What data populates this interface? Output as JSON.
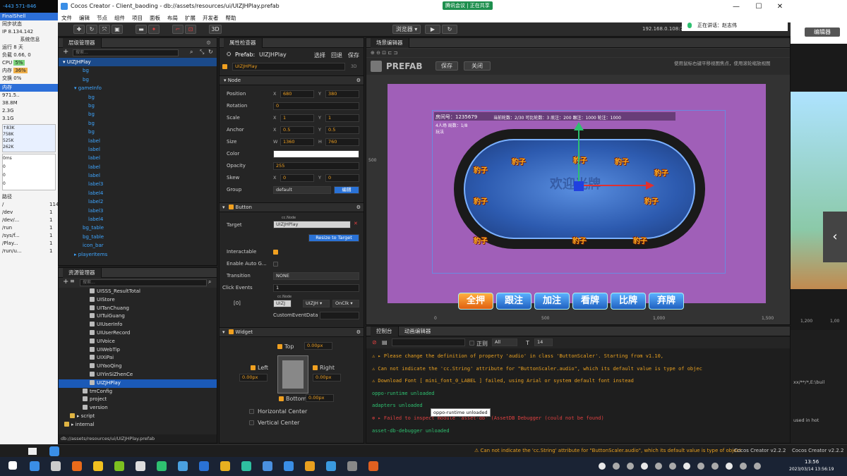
{
  "window": {
    "title": "Cocos Creator - Client_baoding - db://assets/resources/ui/UIZJHPlay.prefab",
    "minimize": "—",
    "maximize": "☐",
    "close": "✕",
    "meeting_badge": "腾讯会议 | 正在共享"
  },
  "menu": [
    "文件",
    "编辑",
    "节点",
    "组件",
    "项目",
    "面板",
    "布局",
    "扩展",
    "开发者",
    "帮助"
  ],
  "toolbar": {
    "mode_3d": "3D",
    "preview_target": "浏览器 ▾",
    "play": "▶",
    "refresh": "↻",
    "ip": "192.168.0.108:74"
  },
  "sysmon": {
    "top_value": "-443 571-846",
    "title": "FinalShell",
    "sync": "同步状态",
    "ip": "IP 8.134.142",
    "sysinfo": "系统信息",
    "uptime": "运行 8 天",
    "load": "负载 0.66, 0",
    "cpu": "CPU",
    "mem": "内存",
    "swap": "交换",
    "cpu_val": "5%",
    "mem_val": "36%",
    "swap_val": "0%",
    "tab1": "内存",
    "rows1": [
      "971.5..",
      "38.8M",
      "2.3G",
      "3.1G"
    ],
    "net": [
      "↑83K",
      "758K",
      "525K",
      "262K"
    ],
    "latency": [
      "0ms",
      "0",
      "0",
      "0"
    ],
    "paths_header": "路径",
    "paths": [
      "/",
      "/dev",
      "/dev/...",
      "/run",
      "/sys/f...",
      "/Play...",
      "/run/u..."
    ],
    "sizes": [
      "114",
      "1",
      "1",
      "1",
      "1",
      "1",
      "1"
    ]
  },
  "hierarchy": {
    "tab": "层级管理器",
    "search_placeholder": "搜索...",
    "items": [
      {
        "label": "▾ UIZJHPlay",
        "indent": 6,
        "selected": true
      },
      {
        "label": "bg",
        "indent": 34
      },
      {
        "label": "bg",
        "indent": 34
      },
      {
        "label": "▾ gameInfo",
        "indent": 22
      },
      {
        "label": "bg",
        "indent": 42
      },
      {
        "label": "bg",
        "indent": 42
      },
      {
        "label": "bg",
        "indent": 42
      },
      {
        "label": "bg",
        "indent": 42
      },
      {
        "label": "bg",
        "indent": 42
      },
      {
        "label": "label",
        "indent": 42
      },
      {
        "label": "label",
        "indent": 42
      },
      {
        "label": "label",
        "indent": 42
      },
      {
        "label": "label",
        "indent": 42
      },
      {
        "label": "label",
        "indent": 42
      },
      {
        "label": "label3",
        "indent": 42
      },
      {
        "label": "label4",
        "indent": 42
      },
      {
        "label": "label2",
        "indent": 42
      },
      {
        "label": "label3",
        "indent": 42
      },
      {
        "label": "label4",
        "indent": 42
      },
      {
        "label": "bg_table",
        "indent": 34
      },
      {
        "label": "bg_table",
        "indent": 34
      },
      {
        "label": "icon_bar",
        "indent": 34
      },
      {
        "label": "▸ playerItems",
        "indent": 22
      }
    ]
  },
  "assets": {
    "tab": "资源管理器",
    "search_placeholder": "搜索...",
    "items": [
      {
        "label": "UISSS_ResultTotal",
        "indent": 44
      },
      {
        "label": "UIStore",
        "indent": 44
      },
      {
        "label": "UITanChuang",
        "indent": 44
      },
      {
        "label": "UITuiGuang",
        "indent": 44
      },
      {
        "label": "UIUserInfo",
        "indent": 44
      },
      {
        "label": "UIUserRecord",
        "indent": 44
      },
      {
        "label": "UIVoice",
        "indent": 44
      },
      {
        "label": "UIWebTip",
        "indent": 44
      },
      {
        "label": "UIXiPai",
        "indent": 44
      },
      {
        "label": "UIYaoQing",
        "indent": 44
      },
      {
        "label": "UIYinSiZhenCe",
        "indent": 44
      },
      {
        "label": "UIZJHPlay",
        "indent": 44,
        "selected": true
      },
      {
        "label": "tmConfig",
        "indent": 34
      },
      {
        "label": "project",
        "indent": 34
      },
      {
        "label": "version",
        "indent": 34
      },
      {
        "label": "▸ script",
        "indent": 16,
        "folder": true
      },
      {
        "label": "▸ internal",
        "indent": 8,
        "folder": true
      }
    ],
    "path": "db://assets/resources/ui/UIZJHPlay.prefab"
  },
  "inspector": {
    "tab": "属性检查器",
    "prefab_label": "Prefab:",
    "prefab_name": "UIZJHPlay",
    "btn_select": "选择",
    "btn_revert": "回退",
    "btn_save": "保存",
    "node_name": "UIZJHPlay",
    "node_3d": "3D",
    "node_section": "Node",
    "position": {
      "label": "Position",
      "x": "680",
      "y": "380"
    },
    "rotation": {
      "label": "Rotation",
      "value": "0"
    },
    "scale": {
      "label": "Scale",
      "x": "1",
      "y": "1"
    },
    "anchor": {
      "label": "Anchor",
      "x": "0.5",
      "y": "0.5"
    },
    "size": {
      "label": "Size",
      "w": "1360",
      "h": "760"
    },
    "color_label": "Color",
    "opacity": {
      "label": "Opacity",
      "value": "255"
    },
    "skew": {
      "label": "Skew",
      "x": "0",
      "y": "0"
    },
    "group": {
      "label": "Group",
      "value": "default",
      "edit": "编辑"
    },
    "button_section": "Button",
    "target": {
      "label": "Target",
      "tag": "cc.Node",
      "value": "UIZJHPlay"
    },
    "resize_btn": "Resize to Target",
    "interactable": "Interactable",
    "enable_auto": "Enable Auto G...",
    "transition": {
      "label": "Transition",
      "value": "NONE"
    },
    "click_events": {
      "label": "Click Events",
      "value": "1"
    },
    "event0": {
      "index": "[0]",
      "node": "UIZJ",
      "comp": "UIZJH ▾",
      "handler": "OnClk ▾",
      "tag": "cc.Node"
    },
    "custom_data": "CustomEventData",
    "widget_section": "Widget",
    "widget": {
      "top": "Top",
      "top_val": "0.00px",
      "left": "Left",
      "left_val": "0.00px",
      "right": "Right",
      "right_val": "0.00px",
      "bottom": "Bottom",
      "bottom_val": "0.00px",
      "hcenter": "Horizontal Center",
      "vcenter": "Vertical Center"
    }
  },
  "scene": {
    "tab": "场景编辑器",
    "prefab_mode": "PREFAB",
    "save": "保存",
    "close": "关闭",
    "hint": "使用鼠标右键平移视图焦点，使用滚轮缩放视图",
    "ruler_left": "500",
    "ruler_bottom": [
      "0",
      "500",
      "1,000",
      "1,500"
    ],
    "room_info": "房间号：1235679",
    "players_info": "4人场  局数：1/8",
    "play_type": "玩法",
    "stats": "当前轮数：2/30   可比轮数：3   底注：200   跟注：1000   轮注：1000",
    "watermark": "欢迎光牌",
    "seat_label": "豹子",
    "buttons": [
      {
        "label": "全押",
        "style": "orange"
      },
      {
        "label": "跟注",
        "style": "blue"
      },
      {
        "label": "加注",
        "style": "blue"
      },
      {
        "label": "看牌",
        "style": "blue"
      },
      {
        "label": "比牌",
        "style": "blue"
      },
      {
        "label": "弃牌",
        "style": "blue"
      }
    ]
  },
  "console": {
    "tab1": "控制台",
    "tab2": "动画编辑器",
    "filter_regex": "正则",
    "filter_all": "All",
    "font_size": "14",
    "lines": [
      {
        "text": "⚠ ▸ Please change the definition of property 'audio' in class 'ButtonScaler'. Starting from v1.10,",
        "level": "warn"
      },
      {
        "text": "⚠ Can not indicate the 'cc.String' attribute for \"ButtonScaler.audio\", which its default value is type of objec",
        "level": "warn"
      },
      {
        "text": "⚠ Download Font [ mini_font_0_LABEL ] failed, using Arial or system default font instead",
        "level": "warn"
      },
      {
        "text": "oppo-runtime unloaded",
        "level": "ok"
      },
      {
        "text": "adapters unloaded",
        "level": "ok"
      },
      {
        "text": "⊗ ▸ Failed to inspect module 'asset-db' (AssetDB Debugger (could not be found)",
        "level": "err"
      },
      {
        "text": "asset-db-debugger unloaded",
        "level": "ok"
      }
    ],
    "tooltip": "oppo-runtime unloaded"
  },
  "statusbar": {
    "message": "⚠ Can not indicate the 'cc.String' attribute for \"ButtonScaler.audio\", which its default value is type of object",
    "version": "Cocos Creator v2.2.2",
    "version2": "Cocos Creator v2.2.2"
  },
  "right_panel": {
    "talking": "正在讲话：赵志伟",
    "btn": "编辑器",
    "terminal_text": "xx/**/*,E:\\buil",
    "terminal_text2": "used in hot",
    "ruler1": "1,200",
    "ruler2": "1,00"
  },
  "taskbar": {
    "time": "13:56",
    "date": "2023/03/14 13:56:19"
  }
}
